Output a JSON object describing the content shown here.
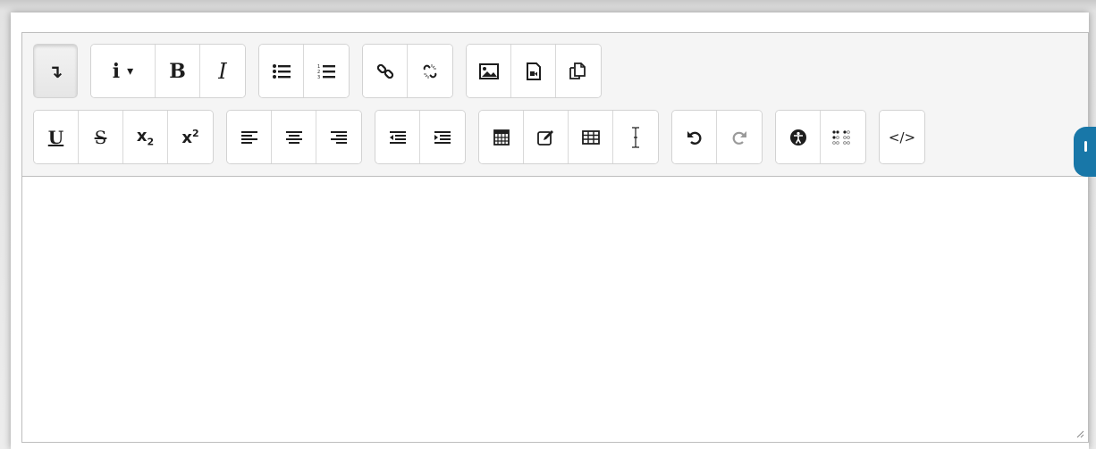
{
  "toolbar": {
    "row1": {
      "toggle": {
        "icon": "collapse-arrow-icon",
        "glyph": "↴"
      },
      "style": {
        "label": "i",
        "caret": "▾"
      },
      "bold": {
        "label": "B"
      },
      "italic": {
        "label": "I"
      },
      "lists": [
        "unordered-list-icon",
        "ordered-list-icon"
      ],
      "links": [
        "link-icon",
        "unlink-icon"
      ],
      "media": [
        "image-icon",
        "media-icon",
        "manage-files-icon"
      ]
    },
    "row2": {
      "underline": {
        "label": "U"
      },
      "strikethrough": {
        "label": "S"
      },
      "subscript": {
        "base": "x",
        "script": "2"
      },
      "superscript": {
        "base": "x",
        "script": "2"
      },
      "align": [
        "align-left-icon",
        "align-center-icon",
        "align-right-icon"
      ],
      "indent": [
        "outdent-icon",
        "indent-icon"
      ],
      "insert": [
        "calculator-icon",
        "equation-icon",
        "table-icon",
        "cursor-icon"
      ],
      "history": [
        "undo-icon",
        "redo-icon"
      ],
      "accessibility": [
        "accessibility-icon",
        "braille-icon"
      ],
      "html": {
        "label": "</>"
      }
    }
  },
  "editor": {
    "content": ""
  },
  "colors": {
    "accent": "#1877a8",
    "toolbar_bg": "#f5f5f5",
    "border": "#bdbdbd",
    "redo_disabled": "#9a9a9a"
  }
}
